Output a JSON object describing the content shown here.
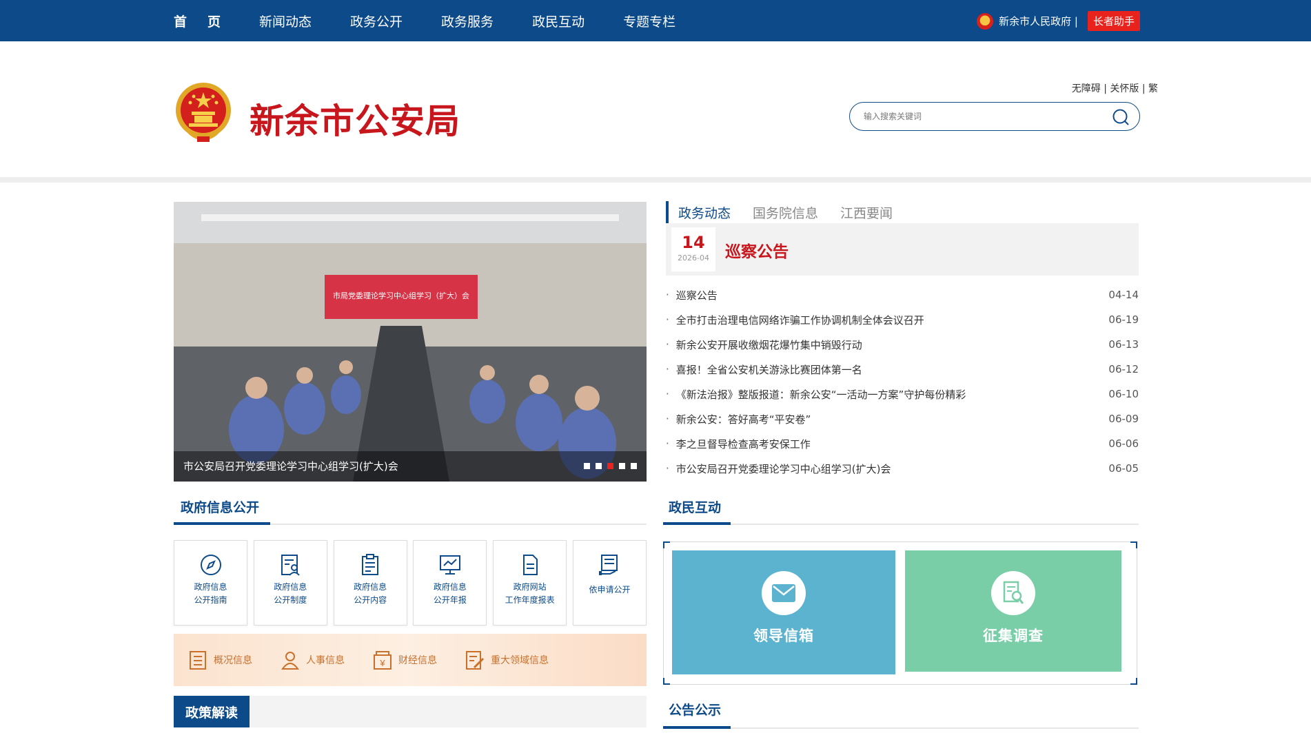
{
  "nav": {
    "items": [
      {
        "label": "首页"
      },
      {
        "label": "新闻动态"
      },
      {
        "label": "政务公开"
      },
      {
        "label": "政务服务"
      },
      {
        "label": "政民互动"
      },
      {
        "label": "专题专栏"
      }
    ],
    "gov_link": "新余市人民政府 |",
    "assistant": "长者助手"
  },
  "header": {
    "site_title": "新余市公安局",
    "access_links": "无障碍 | 关怀版 | 繁",
    "search_placeholder": "输入搜索关键词"
  },
  "carousel": {
    "caption": "市公安局召开党委理论学习中心组学习(扩大)会",
    "banner_text": "市局党委理论学习中心组学习（扩大）会",
    "slide_count": 5,
    "active_index": 2
  },
  "news": {
    "tabs": [
      {
        "label": "政务动态",
        "active": true
      },
      {
        "label": "国务院信息",
        "active": false
      },
      {
        "label": "江西要闻",
        "active": false
      }
    ],
    "featured": {
      "day": "14",
      "year_month": "2026-04",
      "title": "巡察公告"
    },
    "items": [
      {
        "title": "巡察公告",
        "date": "04-14"
      },
      {
        "title": "全市打击治理电信网络诈骗工作协调机制全体会议召开",
        "date": "06-19"
      },
      {
        "title": "新余公安开展收缴烟花爆竹集中销毁行动",
        "date": "06-13"
      },
      {
        "title": "喜报！全省公安机关游泳比赛团体第一名",
        "date": "06-12"
      },
      {
        "title": "《新法治报》整版报道：新余公安“一活动一方案”守护每份精彩",
        "date": "06-10"
      },
      {
        "title": "新余公安：答好高考“平安卷”",
        "date": "06-09"
      },
      {
        "title": "李之旦督导检查高考安保工作",
        "date": "06-06"
      },
      {
        "title": "市公安局召开党委理论学习中心组学习(扩大)会",
        "date": "06-05"
      }
    ]
  },
  "gov_info": {
    "title": "政府信息公开",
    "cards": [
      {
        "line1": "政府信息",
        "line2": "公开指南",
        "icon": "compass-icon"
      },
      {
        "line1": "政府信息",
        "line2": "公开制度",
        "icon": "document-user-icon"
      },
      {
        "line1": "政府信息",
        "line2": "公开内容",
        "icon": "clipboard-icon"
      },
      {
        "line1": "政府信息",
        "line2": "公开年报",
        "icon": "monitor-chart-icon"
      },
      {
        "line1": "政府网站",
        "line2": "工作年度报表",
        "icon": "file-icon"
      },
      {
        "line1": "依申请公开",
        "line2": "",
        "icon": "form-hand-icon"
      }
    ],
    "strip": [
      {
        "label": "概况信息",
        "icon": "list-doc-icon"
      },
      {
        "label": "人事信息",
        "icon": "person-icon"
      },
      {
        "label": "财经信息",
        "icon": "yuan-icon"
      },
      {
        "label": "重大领域信息",
        "icon": "edit-doc-icon"
      }
    ]
  },
  "interaction": {
    "title": "政民互动",
    "mailbox": "领导信箱",
    "survey": "征集调查"
  },
  "policy": {
    "title": "政策解读"
  },
  "notice": {
    "title": "公告公示"
  },
  "colors": {
    "brand_blue": "#0d4a8a",
    "accent_red": "#c8161d",
    "tile_blue": "#5cb3cf",
    "tile_green": "#79cda7"
  }
}
